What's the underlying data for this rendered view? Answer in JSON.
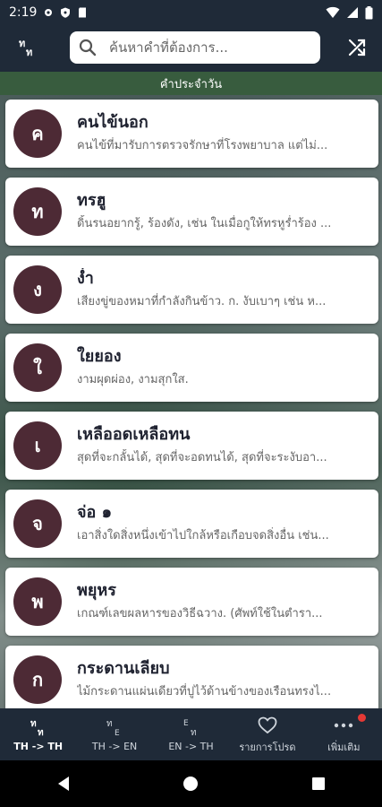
{
  "status": {
    "time": "2:19"
  },
  "app": {
    "logo_glyph": "ท"
  },
  "search": {
    "placeholder": "ค้นหาคำที่ต้องการ..."
  },
  "section": {
    "title": "คำประจำวัน"
  },
  "words": [
    {
      "initial": "ค",
      "word": "คนไข้นอก",
      "meaning": "คนไข้ที่มารับการตรวจรักษาที่โรงพยาบาล แต่ไม่..."
    },
    {
      "initial": "ท",
      "word": "ทรฮู",
      "meaning": "ดิ้นรนอยากรู้, ร้องดัง, เช่น ในเมื่อกูให้ทรหูร่ำร้อง ..."
    },
    {
      "initial": "ง",
      "word": "ง่ำ",
      "meaning": "เสียงขู่ของหมาที่กำลังกินข้าว.  ก. งับเบาๆ เช่น ห..."
    },
    {
      "initial": "ใ",
      "word": "ใยยอง",
      "meaning": "งามผุดผ่อง, งามสุกใส."
    },
    {
      "initial": "เ",
      "word": "เหลืออดเหลือทน",
      "meaning": "สุดที่จะกลั้นได้, สุดที่จะอดทนได้, สุดที่จะระงับอา..."
    },
    {
      "initial": "จ",
      "word": "จ่อ ๑",
      "meaning": "เอาสิ่งใดสิ่งหนึ่งเข้าไปใกล้หรือเกือบจดสิ่งอื่น เช่น..."
    },
    {
      "initial": "พ",
      "word": "พยุหร",
      "meaning": "เกณฑ์เลขผลหารของวิธีฉวาง.  (ศัพท์ใช้ในตำรา..."
    },
    {
      "initial": "ก",
      "word": "กระดานเลียบ",
      "meaning": "ไม้กระดานแผ่นเดียวที่ปูไว้ด้านข้างของเรือนทรงไ..."
    }
  ],
  "nav": [
    {
      "label": "TH -> TH",
      "icon_top": "ท",
      "icon_bottom": "ท"
    },
    {
      "label": "TH -> EN",
      "icon_top": "ท",
      "icon_bottom": "E"
    },
    {
      "label": "EN -> TH",
      "icon_top": "E",
      "icon_bottom": "ท"
    },
    {
      "label": "รายการโปรด",
      "icon": "heart-icon"
    },
    {
      "label": "เพิ่มเติม",
      "icon": "more-icon"
    }
  ]
}
